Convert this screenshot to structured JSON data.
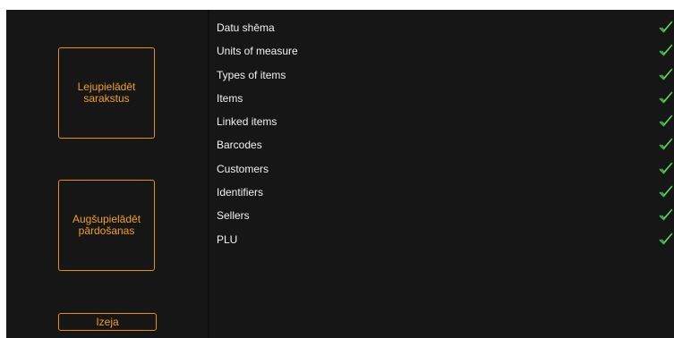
{
  "left_panel": {
    "download_button": {
      "line1": "Lejupielādēt",
      "line2": "sarakstus"
    },
    "upload_button": {
      "line1": "Augšupielādēt",
      "line2": "pārdošanas"
    },
    "exit_label": "Izeja"
  },
  "sync_items": [
    {
      "label": "Datu shēma",
      "status": "done"
    },
    {
      "label": "Units of measure",
      "status": "done"
    },
    {
      "label": "Types of items",
      "status": "done"
    },
    {
      "label": "Items",
      "status": "done"
    },
    {
      "label": "Linked items",
      "status": "done"
    },
    {
      "label": "Barcodes",
      "status": "done"
    },
    {
      "label": "Customers",
      "status": "done"
    },
    {
      "label": "Identifiers",
      "status": "done"
    },
    {
      "label": "Sellers",
      "status": "done"
    },
    {
      "label": "PLU",
      "status": "done"
    }
  ],
  "icons": {
    "status_done": "checkmark-icon"
  },
  "colors": {
    "background": "#161616",
    "accent": "#e8900c",
    "accent_text": "#f0a020",
    "text": "#f2f2f2",
    "check": "#3cc43c"
  }
}
